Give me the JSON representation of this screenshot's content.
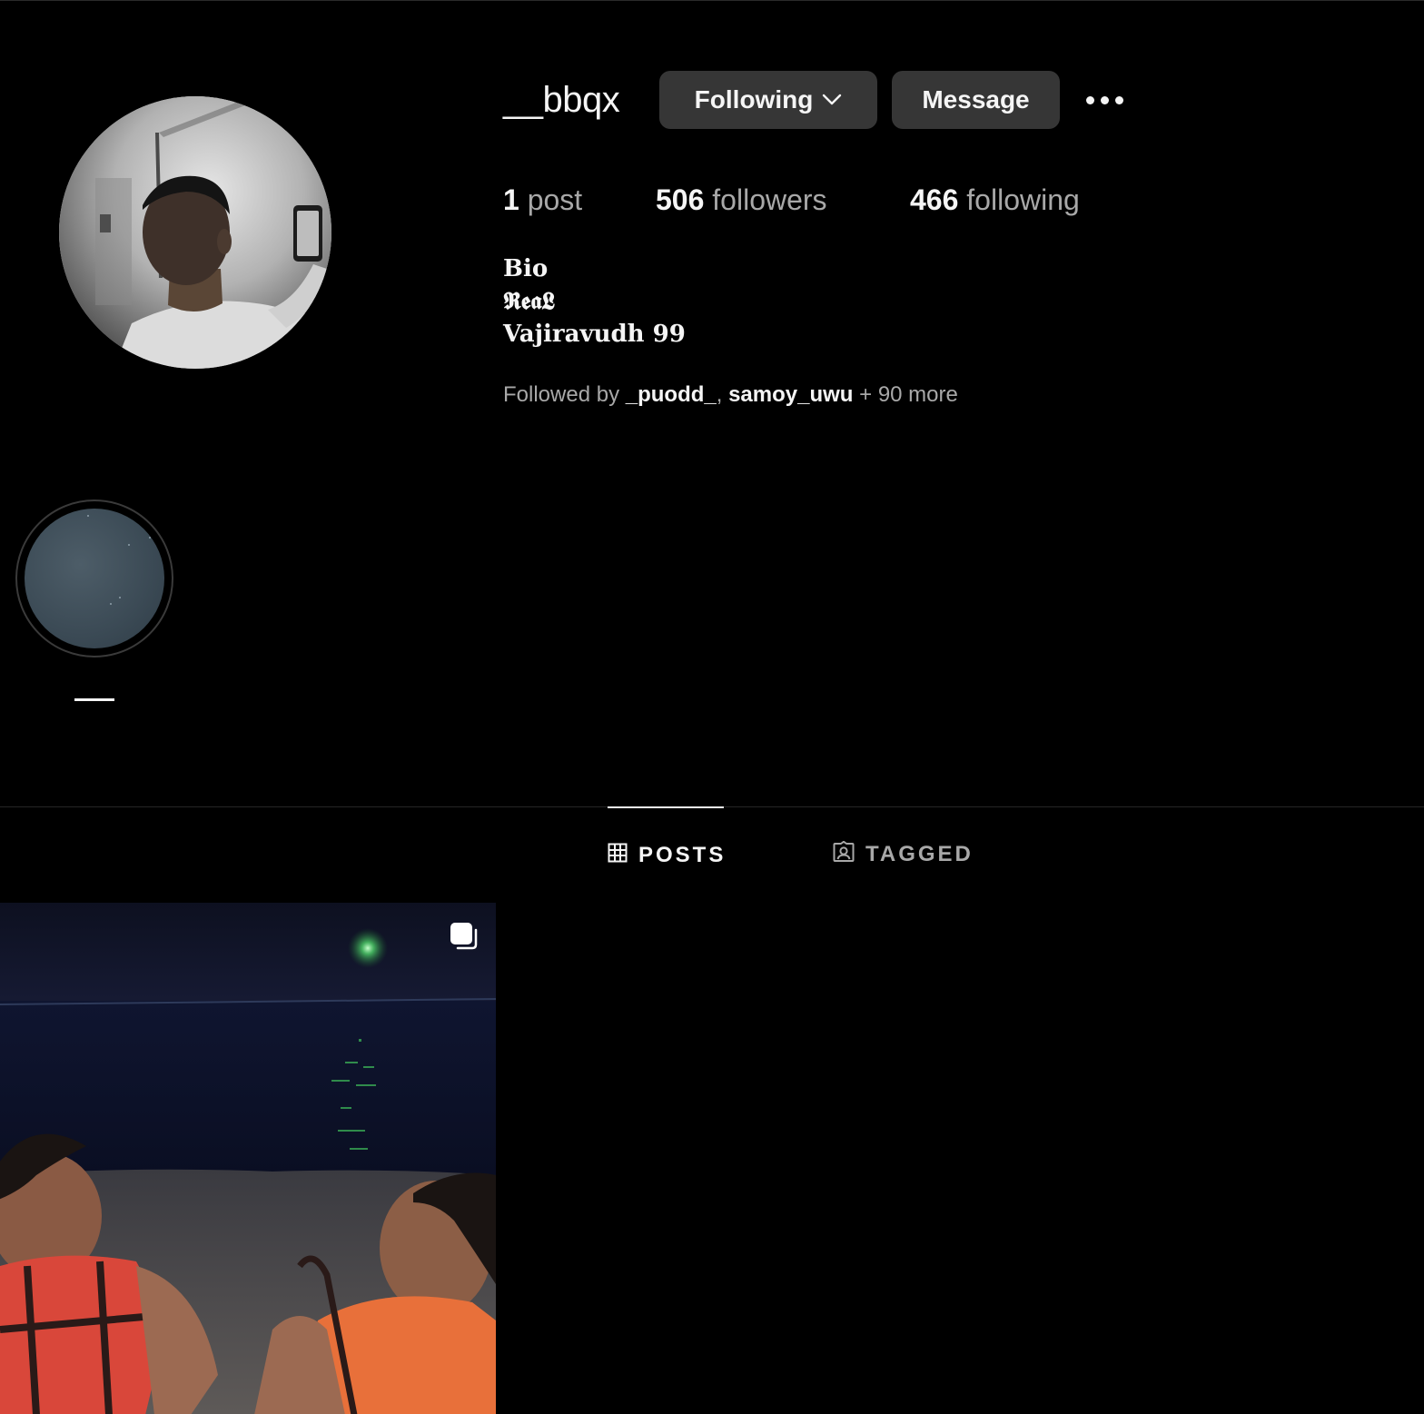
{
  "profile": {
    "username": "__bbqx",
    "following_button": "Following",
    "message_button": "Message",
    "stats": {
      "posts_count": "1",
      "posts_label": " post",
      "followers_count": "506",
      "followers_label": " followers",
      "following_count": "466",
      "following_label": " following"
    },
    "bio": {
      "line1": "Bio",
      "line2": "𝕽𝖊𝖆𝕷",
      "line3": "Vajiravudh 99"
    },
    "followed_by": {
      "prefix": "Followed by ",
      "user1": "_puodd_",
      "separator": ", ",
      "user2": "samoy_uwu",
      "suffix": " + 90 more"
    }
  },
  "highlights": [
    {
      "label": ""
    }
  ],
  "tabs": {
    "posts": "POSTS",
    "tagged": "TAGGED"
  },
  "icons": {
    "chevron": "chevron-down-icon",
    "more": "more-options-icon",
    "grid": "grid-icon",
    "tagged": "tagged-icon",
    "carousel": "carousel-icon"
  },
  "colors": {
    "background": "#000000",
    "button_bg": "#363636",
    "primary_text": "#f5f5f5",
    "secondary_text": "#a8a8a8"
  }
}
